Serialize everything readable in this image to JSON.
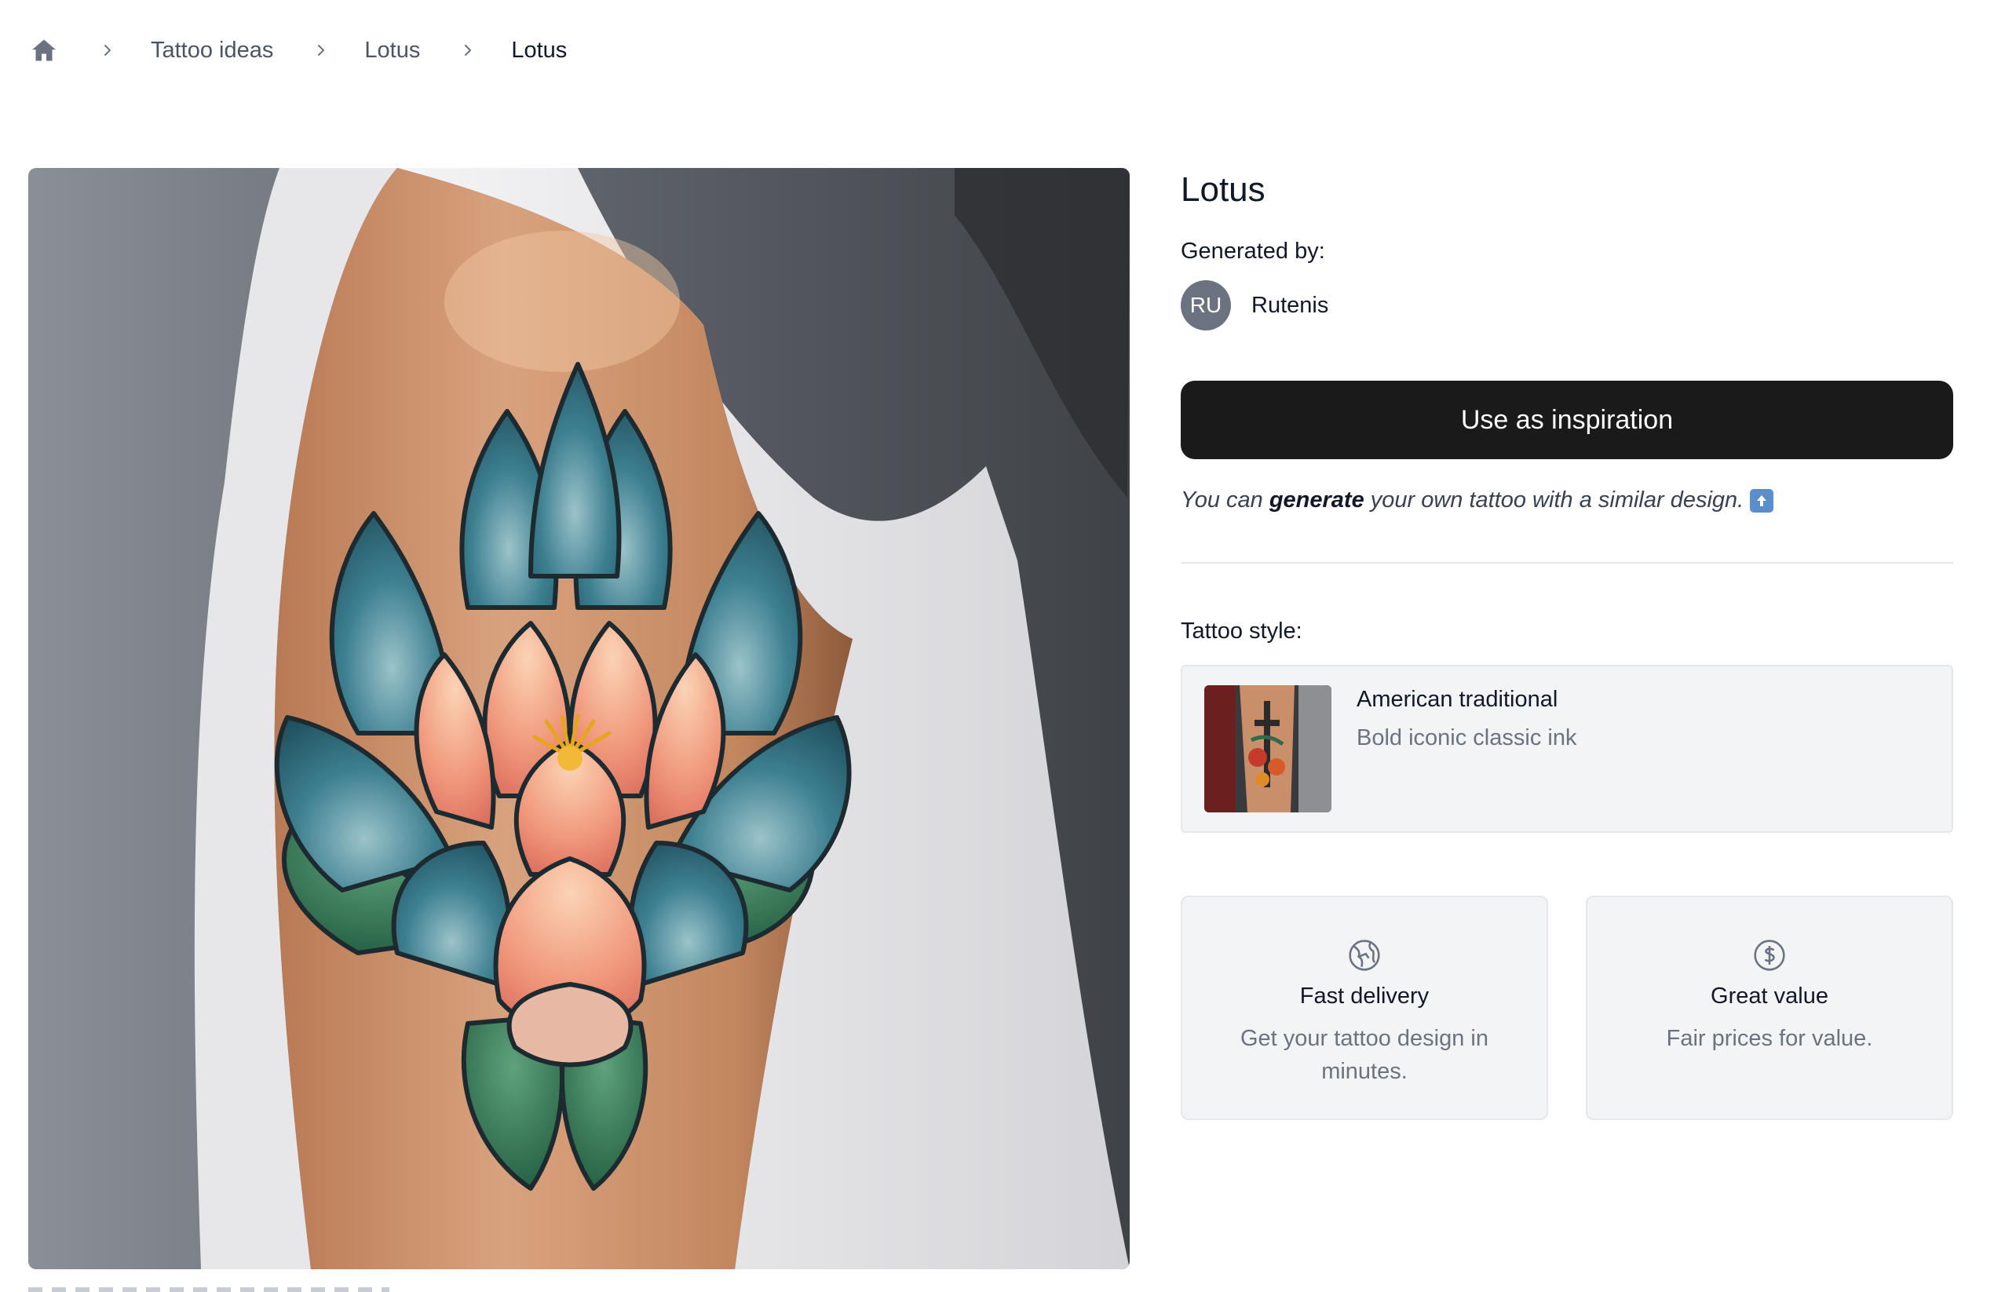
{
  "breadcrumb": {
    "home_icon": "home-icon",
    "items": [
      "Tattoo ideas",
      "Lotus",
      "Lotus"
    ]
  },
  "design": {
    "title": "Lotus",
    "generated_by_label": "Generated by:",
    "author": {
      "initials": "RU",
      "name": "Rutenis"
    },
    "cta_label": "Use as inspiration",
    "hint": {
      "prefix": "You can",
      "emphasis": "generate",
      "suffix": "your own tattoo with a similar design.",
      "icon": "up-arrow-icon"
    }
  },
  "style": {
    "label": "Tattoo style:",
    "name": "American traditional",
    "description": "Bold iconic classic ink"
  },
  "features": [
    {
      "icon": "globe-icon",
      "title": "Fast delivery",
      "description": "Get your tattoo design in minutes."
    },
    {
      "icon": "dollar-icon",
      "title": "Great value",
      "description": "Fair prices for value."
    }
  ],
  "colors": {
    "cta_background": "#1a1a1a",
    "avatar_background": "#6b7280",
    "card_background": "#f3f4f6",
    "lotus_teal": "#2f7183",
    "lotus_peach": "#f0a07e"
  }
}
